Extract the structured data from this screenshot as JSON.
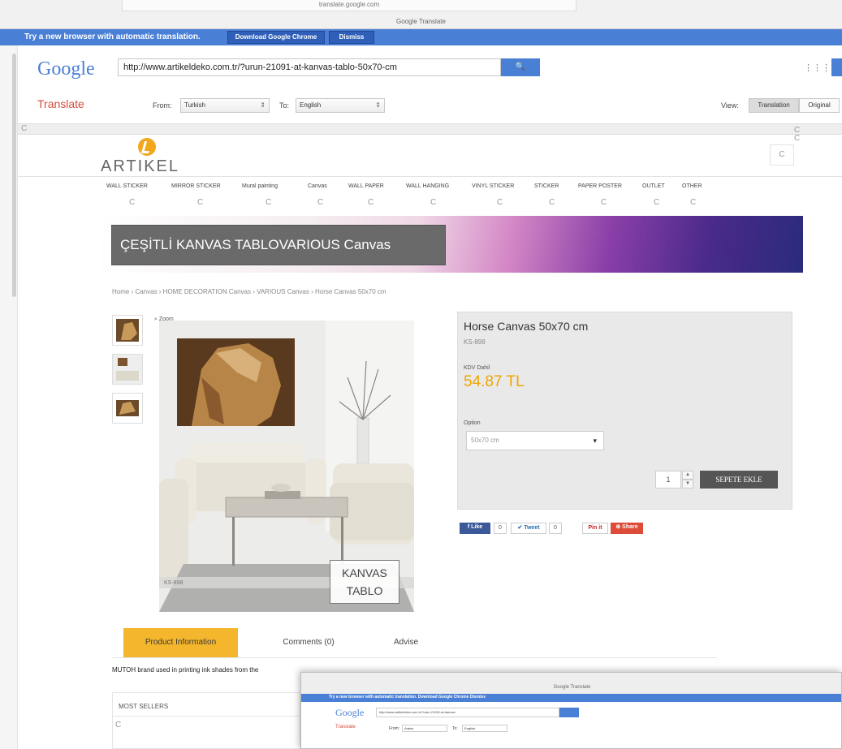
{
  "browser": {
    "url_fragment": "translate.google.com",
    "window_title": "Google Translate"
  },
  "promo": {
    "text": "Try a new browser with automatic translation.",
    "download_btn": "Download Google Chrome",
    "dismiss_btn": "Dismiss"
  },
  "google": {
    "logo": "Google",
    "url_value": "http://www.artikeldeko.com.tr/?urun-21091-at-kanvas-tablo-50x70-cm",
    "search_glyph": "🔍",
    "apps_glyph": "⋮⋮⋮"
  },
  "translate": {
    "label": "Translate",
    "from_label": "From:",
    "from_value": "Turkish",
    "to_label": "To:",
    "to_value": "English",
    "view_label": "View:",
    "view_translation": "Translation",
    "view_original": "Original",
    "spinner": "C"
  },
  "site": {
    "logo": "ARTIKEL",
    "nav": [
      "WALL STICKER",
      "MIRROR STICKER",
      "Mural painting",
      "Canvas",
      "WALL PAPER",
      "WALL HANGING",
      "VINYL STICKER",
      "STICKER",
      "PAPER POSTER",
      "OUTLET",
      "OTHER"
    ],
    "banner": "ÇEŞİTLİ KANVAS TABLOVARIOUS Canvas",
    "breadcrumb": "Home › Canvas › HOME DECORATION Canvas › VARIOUS Canvas › Horse Canvas 50x70 cm"
  },
  "product": {
    "zoom": "Zoom",
    "image_code": "KS-898",
    "watermark_1": "KANVAS",
    "watermark_2": "TABLO",
    "title": "Horse Canvas 50x70 cm",
    "code": "KS-898",
    "vat_label": "KDV Dahil",
    "price": "54.87 TL",
    "option_label": "Option",
    "option_value": "50x70 cm",
    "qty": "1",
    "add_to_cart": "SEPETE EKLE",
    "like": "Like",
    "like_count": "0",
    "tweet": "Tweet",
    "tweet_count": "0",
    "pin": "Pin it",
    "share": "Share"
  },
  "tabs": {
    "info": "Product Information",
    "comments": "Comments (0)",
    "advise": "Advise"
  },
  "description": "MUTOH brand used in printing ink shades from the",
  "sidebar": {
    "best_sellers": "MOST SELLERS"
  },
  "window2": {
    "title": "Google Translate",
    "promo": "Try a new browser with automatic translation.    Download Google Chrome    Dismiss",
    "logo": "Google",
    "url": "http://www.artikeldeko.com.tr/?urun-21091-at-kanvas",
    "translate": "Translate",
    "from_value": "Arabic",
    "to_value": "English"
  },
  "colors": {
    "google_blue": "#4a7fd6",
    "translate_red": "#d64b3a",
    "price_orange": "#f0a500",
    "tab_active": "#f3b62c"
  }
}
